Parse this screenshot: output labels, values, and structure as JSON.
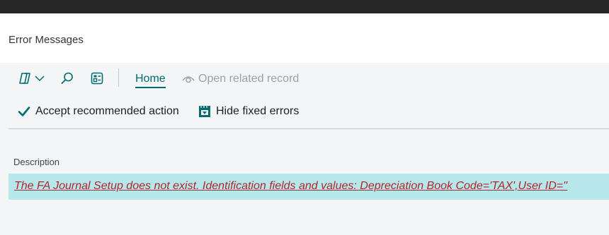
{
  "page": {
    "title": "Error Messages"
  },
  "toolbar": {
    "icons": [
      "copilot-icon",
      "chevron-down-icon",
      "search-icon",
      "list-view-icon"
    ],
    "tabs": [
      {
        "label": "Home",
        "selected": true
      },
      {
        "label": "Open related record",
        "enabled": false
      }
    ]
  },
  "actions": {
    "accept_label": "Accept recommended action",
    "hide_label": "Hide fixed errors"
  },
  "table": {
    "columns": [
      "Description"
    ],
    "rows": [
      {
        "description": "The FA Journal Setup does not exist. Identification fields and values: Depreciation Book Code='TAX',User ID=''"
      }
    ]
  },
  "colors": {
    "accent": "#006c6c",
    "error_text": "#b0282e",
    "selected_row": "#b6e7ea",
    "top_bar": "#262626"
  }
}
